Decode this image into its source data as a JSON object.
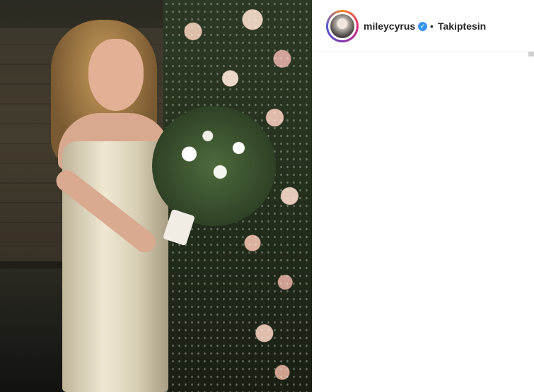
{
  "post": {
    "username": "mileycyrus",
    "verified_badge": "✓",
    "separator": "•",
    "follow_status": "Takiptesin"
  },
  "icons": {
    "verified": "verified-badge-icon"
  },
  "colors": {
    "verified_blue": "#3897f0",
    "text": "#262626",
    "divider": "#efefef"
  }
}
